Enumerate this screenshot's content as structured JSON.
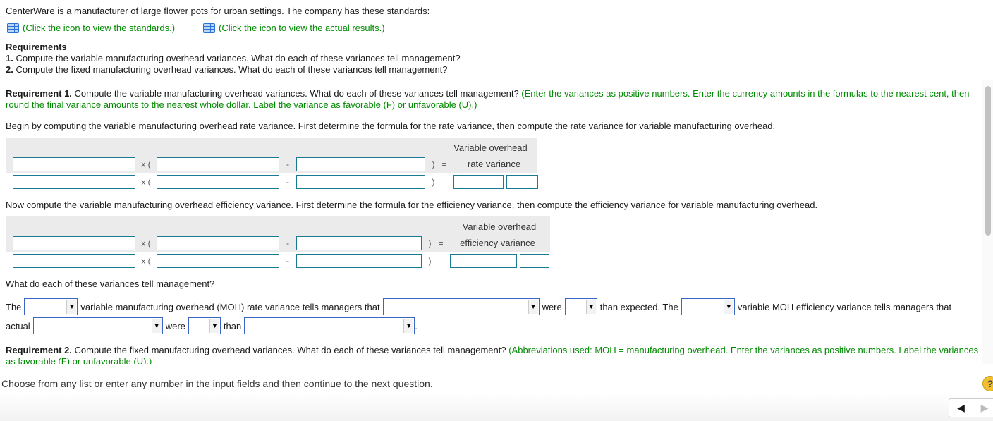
{
  "intro": "CenterWare is a manufacturer of large flower pots for urban settings. The company has these standards:",
  "links": [
    {
      "icon": "table-icon",
      "label": "(Click the icon to view the standards.)"
    },
    {
      "icon": "table-icon",
      "label": "(Click the icon to view the actual results.)"
    }
  ],
  "requirements": {
    "heading": "Requirements",
    "items": [
      {
        "num": "1.",
        "text": " Compute the variable manufacturing overhead variances. What do each of these variances tell management?"
      },
      {
        "num": "2.",
        "text": " Compute the fixed manufacturing overhead variances. What do each of these variances tell management?"
      }
    ]
  },
  "req1": {
    "label": "Requirement 1.",
    "text": " Compute the variable manufacturing overhead variances. What do each of these variances tell management? ",
    "instruction": "(Enter the variances as positive numbers. Enter the currency amounts in the formulas to the nearest cent, then round the final variance amounts to the nearest whole dollar. Label the variance as favorable (F) or unfavorable (U).)",
    "begin": "Begin by computing the variable manufacturing overhead rate variance. First determine the formula for the rate variance, then compute the rate variance for variable manufacturing overhead.",
    "rate_table": {
      "header_line1": "Variable overhead",
      "header_line2": "rate variance",
      "times": "x (",
      "minus": "-",
      "close_eq": ")   ="
    },
    "now": "Now compute the variable manufacturing overhead efficiency variance. First determine the formula for the efficiency variance, then compute the efficiency variance for variable manufacturing overhead.",
    "eff_table": {
      "header_line1": "Variable overhead",
      "header_line2": "efficiency variance",
      "times": "x (",
      "minus": "-",
      "close_eq": ")   ="
    },
    "what": "What do each of these variances tell management?",
    "sentence": {
      "s1": "The",
      "s2": "variable manufacturing overhead (MOH) rate variance tells managers that",
      "s3": "were",
      "s4": "than expected. The",
      "s5": "variable MOH efficiency variance tells managers that",
      "s6": "actual",
      "s7": "were",
      "s8": "than",
      "s9": "."
    },
    "dropdown_arrow": "▼"
  },
  "req2": {
    "label": "Requirement 2.",
    "text": " Compute the fixed manufacturing overhead variances. What do each of these variances tell management? ",
    "instruction": "(Abbreviations used: MOH = manufacturing overhead. Enter the variances as positive numbers. Label the variances as favorable (F) or unfavorable (U).)"
  },
  "status": "Choose from any list or enter any number in the input fields and then continue to the next question.",
  "help_label": "?",
  "nav": {
    "prev": "◀",
    "next": "▶"
  }
}
